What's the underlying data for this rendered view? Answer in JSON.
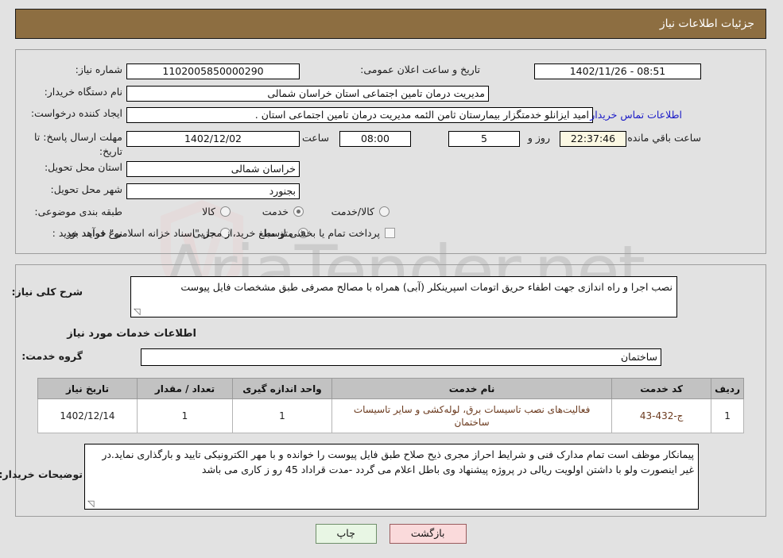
{
  "header": {
    "title": "جزئیات اطلاعات نیاز"
  },
  "watermark": {
    "text": "AriaTender.net"
  },
  "form": {
    "need_number": {
      "label": "شماره نیاز:",
      "value": "1102005850000290"
    },
    "announce_datetime": {
      "label": "تاریخ و ساعت اعلان عمومی:",
      "value": "08:51 - 1402/11/26"
    },
    "buyer_org": {
      "label": "نام دستگاه خریدار:",
      "value": "مدیریت درمان تامین اجتماعی استان خراسان شمالی"
    },
    "creator": {
      "label": "ایجاد کننده درخواست:",
      "value": "امید ایزانلو خدمتگزار بیمارستان ثامن الئمه مدیریت درمان تامین اجتماعی استان .",
      "contact_link": "اطلاعات تماس خریدار"
    },
    "deadline": {
      "label": "مهلت ارسال پاسخ: تا تاریخ:",
      "date": "1402/12/02",
      "hour_label": "ساعت",
      "hour": "08:00",
      "days": "5",
      "days_sep": "روز و",
      "countdown": "22:37:46",
      "remaining_label": "ساعت باقي مانده"
    },
    "province": {
      "label": "استان محل تحویل:",
      "value": "خراسان شمالی"
    },
    "city": {
      "label": "شهر محل تحویل:",
      "value": "بجنورد"
    },
    "category": {
      "label": "طبقه بندی موضوعی:",
      "options": [
        "کالا",
        "خدمت",
        "کالا/خدمت"
      ],
      "selected": "خدمت"
    },
    "purchase_type": {
      "label": "نوع فرآیند خرید :",
      "options": [
        "جزیی",
        "متوسط"
      ],
      "selected": "متوسط",
      "treasury_checkbox_label": "پرداخت تمام یا بخشی از مبلغ خرید،از محل \"اسناد خزانه اسلامی\" خواهد بود.",
      "treasury_checked": false
    },
    "general_description": {
      "label": "شرح کلی نیاز:",
      "value": "نصب اجرا و راه اندازی جهت اطفاء حریق اتومات اسپرینکلر (آبی) همراه با مصالح مصرفی طبق مشخصات فایل پیوست"
    },
    "services_heading": "اطلاعات خدمات مورد نیاز",
    "service_group": {
      "label": "گروه خدمت:",
      "value": "ساختمان"
    },
    "buyer_notes": {
      "label": "توضیحات خریدار:",
      "value": "پیمانکار موظف است تمام مدارک فنی و شرایط احراز  مجری ذیح صلاح طبق فایل پیوست را خوانده و با مهر الکترونیکی تایید و بارگذاری نماید.در غیر اینصورت ولو با داشتن اولویت ریالی در پروژه پیشنهاد وی باطل اعلام می گردد -مدت قراداد 45 رو ز کاری می باشد"
    }
  },
  "items_table": {
    "columns": [
      "ردیف",
      "کد خدمت",
      "نام خدمت",
      "واحد اندازه گیری",
      "تعداد / مقدار",
      "تاریخ نیاز"
    ],
    "rows": [
      {
        "row_no": "1",
        "service_code": "ج-432-43",
        "service_name": "فعالیت‌های نصب تاسیسات برق، لوله‌کشی و سایر تاسیسات ساختمان",
        "unit": "1",
        "quantity": "1",
        "need_date": "1402/12/14"
      }
    ]
  },
  "buttons": {
    "print": "چاپ",
    "back": "بازگشت"
  },
  "colors": {
    "header_bg": "#8d6e41",
    "page_bg": "#e2e2e2",
    "link": "#1a1ac7",
    "table_header_bg": "#c2c2c2",
    "table_text": "#6b3a1e",
    "print_btn_bg": "#e8f6e4",
    "back_btn_bg": "#fadadb",
    "countdown_bg": "#fbf8e3"
  }
}
